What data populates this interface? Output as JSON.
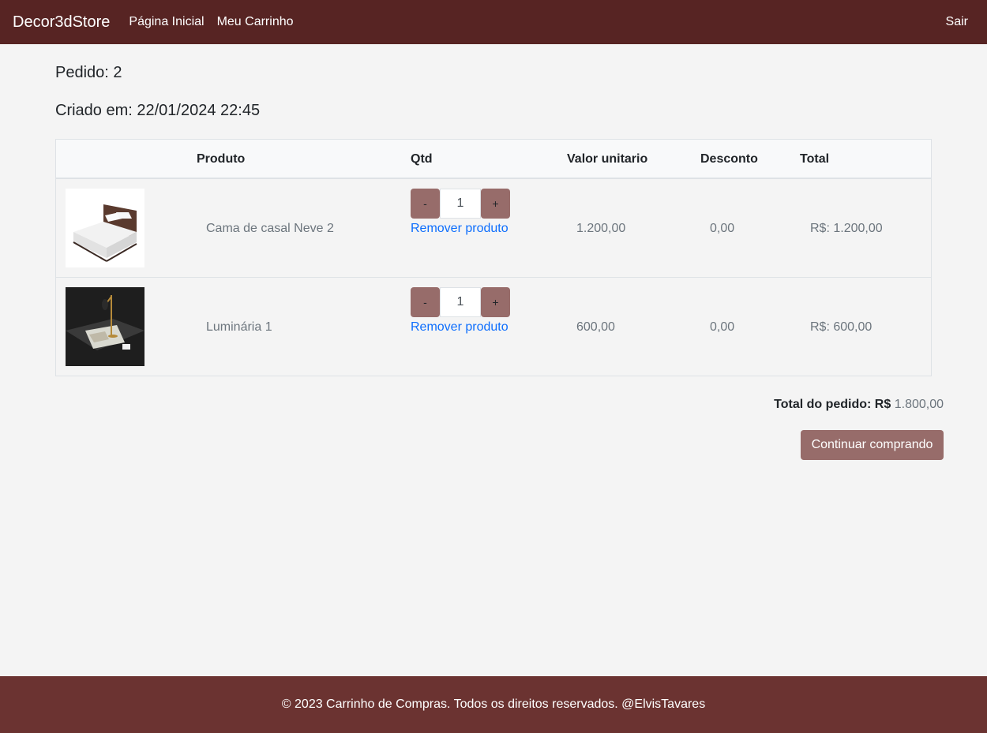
{
  "navbar": {
    "brand": "Decor3dStore",
    "links": [
      "Página Inicial",
      "Meu Carrinho"
    ],
    "logout": "Sair"
  },
  "order": {
    "title": "Pedido: 2",
    "created": "Criado em: 22/01/2024 22:45"
  },
  "table": {
    "headers": [
      "Produto",
      "Qtd",
      "Valor unitario",
      "Desconto",
      "Total"
    ],
    "rows": [
      {
        "product": "Cama de casal Neve 2",
        "qty": "1",
        "unit_price": "1.200,00",
        "discount": "0,00",
        "total": "R$: 1.200,00",
        "remove": "Remover produto",
        "minus": "-",
        "plus": "+",
        "image": "bed-image"
      },
      {
        "product": "Luminária 1",
        "qty": "1",
        "unit_price": "600,00",
        "discount": "0,00",
        "total": "R$: 600,00",
        "remove": "Remover produto",
        "minus": "-",
        "plus": "+",
        "image": "lamp-image"
      }
    ]
  },
  "summary": {
    "total_label": "Total do pedido: R$",
    "total_value": "1.800,00",
    "continue": "Continuar comprando"
  },
  "footer": {
    "text": "© 2023 Carrinho de Compras. Todos os direitos reservados. @ElvisTavares"
  },
  "colors": {
    "navbar": "#572423",
    "footer": "#6b3331",
    "button": "#976c6a",
    "link": "#0d6efd"
  }
}
